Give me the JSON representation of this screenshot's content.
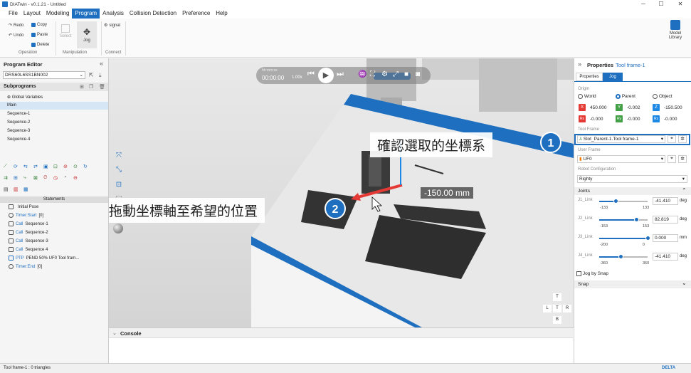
{
  "window": {
    "title": "DIATwin - v0.1.21 - Untitled",
    "minimize": "─",
    "maximize": "☐",
    "close": "✕"
  },
  "menu": [
    "File",
    "Layout",
    "Modeling",
    "Program",
    "Analysis",
    "Collision Detection",
    "Preference",
    "Help"
  ],
  "ribbon": {
    "redo": "Redo",
    "undo": "Undo",
    "copy": "Copy",
    "paste": "Paste",
    "delete": "Delete",
    "operation": "Operation",
    "select": "Select",
    "jog": "Jog",
    "manipulation": "Manipulation",
    "signal": "signal",
    "connect": "Connect",
    "model_library": "Model Library"
  },
  "program_editor": {
    "title": "Program Editor",
    "robot": "DRS60L6SS1BN002",
    "subprograms_title": "Subprograms",
    "subprograms": [
      "Global Variables",
      "Main",
      "Sequence-1",
      "Sequence-2",
      "Sequence-3",
      "Sequence-4"
    ],
    "statements_title": "Statements",
    "statements": [
      {
        "kw": "",
        "text": "Initial Pose"
      },
      {
        "kw": "Timer:Start",
        "text": "[0]"
      },
      {
        "kw": "Call",
        "text": "Sequence-1"
      },
      {
        "kw": "Call",
        "text": "Sequence-2"
      },
      {
        "kw": "Call",
        "text": "Sequence-3"
      },
      {
        "kw": "Call",
        "text": "Sequence 4"
      },
      {
        "kw": "PTP",
        "text": "PEND 50% UF0 Tool fram..."
      },
      {
        "kw": "Timer:End",
        "text": "[0]"
      }
    ]
  },
  "playback": {
    "time_label": "hh:mm:ss",
    "time": "00:00:00",
    "speed": "1.00x"
  },
  "viewport": {
    "dimension": "-150.00 mm",
    "callout1": "確認選取的坐標系",
    "callout2": "拖動坐標軸至希望的位置",
    "step1": "1",
    "step2": "2"
  },
  "console": {
    "title": "Console"
  },
  "properties": {
    "header": "Properties",
    "object": "Tool frame-1",
    "tabs": [
      "Properties",
      "Jog"
    ],
    "origin_label": "Origin",
    "origin_options": [
      "World",
      "Parent",
      "Object"
    ],
    "origin_selected": "Parent",
    "coords": {
      "x": "450.000",
      "y": "-0.002",
      "z": "-150.500",
      "rx": "-0.000",
      "ry": "-0.000",
      "rz": "-0.000"
    },
    "tool_frame_label": "Tool Frame",
    "tool_frame": "Slot_Parent-1.Tool frame-1",
    "user_frame_label": "User Frame",
    "user_frame": "UF0",
    "robot_config_label": "Robot Configuration",
    "robot_config": "Righty",
    "joints_label": "Joints",
    "joints": [
      {
        "name": "J1_Link",
        "value": "-41.410",
        "unit": "deg",
        "min": "-133",
        "max": "133",
        "pos": 0.34
      },
      {
        "name": "J2_Link",
        "value": "82.819",
        "unit": "deg",
        "min": "-153",
        "max": "153",
        "pos": 0.77
      },
      {
        "name": "J3_Link",
        "value": "0.000",
        "unit": "mm",
        "min": "-200",
        "max": "0",
        "pos": 1.0
      },
      {
        "name": "J4_Link",
        "value": "-41.410",
        "unit": "deg",
        "min": "-360",
        "max": "360",
        "pos": 0.44
      }
    ],
    "jog_by_snap": "Jog by Snap",
    "snap": "Snap"
  },
  "status": {
    "text": "Tool frame-1 : 0 triangles",
    "brand": "DELTA"
  },
  "colors": {
    "accent": "#1e6fbf",
    "x": "#e53935",
    "y": "#43a047",
    "z": "#1e88e5"
  }
}
